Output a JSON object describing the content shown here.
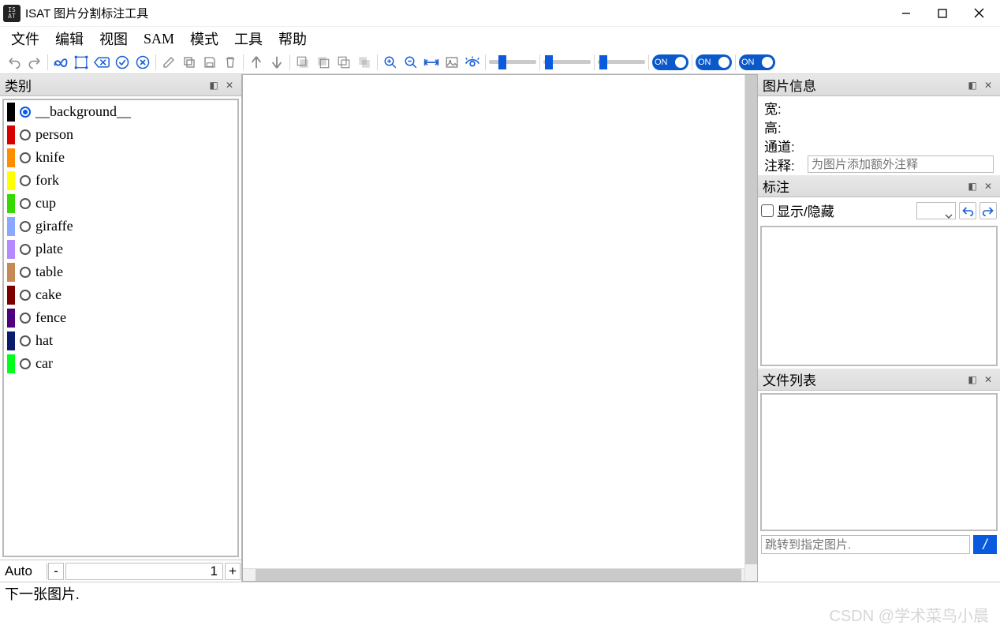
{
  "window": {
    "title": "ISAT 图片分割标注工具",
    "app_icon_text": "IS\nAT"
  },
  "menubar": [
    "文件",
    "编辑",
    "视图",
    "SAM",
    "模式",
    "工具",
    "帮助"
  ],
  "toolbar": {
    "toggle_labels": [
      "ON",
      "ON",
      "ON"
    ]
  },
  "categories": {
    "title": "类别",
    "items": [
      {
        "color": "#000000",
        "label": "__background__",
        "selected": true
      },
      {
        "color": "#d70000",
        "label": "person",
        "selected": false
      },
      {
        "color": "#ff8d00",
        "label": "knife",
        "selected": false
      },
      {
        "color": "#ffff00",
        "label": "fork",
        "selected": false
      },
      {
        "color": "#36d900",
        "label": "cup",
        "selected": false
      },
      {
        "color": "#8aa8ff",
        "label": "giraffe",
        "selected": false
      },
      {
        "color": "#b38bff",
        "label": "plate",
        "selected": false
      },
      {
        "color": "#c78a57",
        "label": "table",
        "selected": false
      },
      {
        "color": "#7a0000",
        "label": "cake",
        "selected": false
      },
      {
        "color": "#4f007c",
        "label": "fence",
        "selected": false
      },
      {
        "color": "#0b1b6e",
        "label": "hat",
        "selected": false
      },
      {
        "color": "#00ff1a",
        "label": "car",
        "selected": false
      }
    ],
    "mode": "Auto",
    "minus": "-",
    "value": "1",
    "plus": "+"
  },
  "image_info": {
    "title": "图片信息",
    "width_label": "宽:",
    "height_label": "高:",
    "channel_label": "通道:",
    "note_label": "注释:",
    "note_placeholder": "为图片添加额外注释"
  },
  "annotation": {
    "title": "标注",
    "show_hide": "显示/隐藏"
  },
  "file_list": {
    "title": "文件列表",
    "jump_placeholder": "跳转到指定图片.",
    "go_label": "/"
  },
  "statusbar": {
    "text": "下一张图片."
  },
  "watermark": "CSDN @学术菜鸟小晨"
}
